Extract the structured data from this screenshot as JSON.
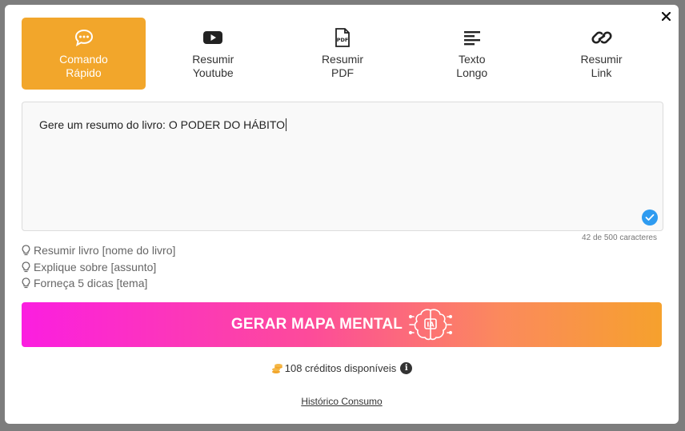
{
  "tabs": [
    {
      "label": "Comando\nRápido",
      "icon": "chat-bubble-icon",
      "active": true
    },
    {
      "label": "Resumir\nYoutube",
      "icon": "youtube-icon",
      "active": false
    },
    {
      "label": "Resumir\nPDF",
      "icon": "pdf-file-icon",
      "active": false
    },
    {
      "label": "Texto\nLongo",
      "icon": "align-left-icon",
      "active": false
    },
    {
      "label": "Resumir\nLink",
      "icon": "link-icon",
      "active": false
    }
  ],
  "prompt": {
    "value": "Gere um resumo do livro: O PODER DO HÁBITO",
    "char_count": "42 de 500 caracteres"
  },
  "suggestions": [
    "Resumir livro [nome do livro]",
    "Explique sobre [assunto]",
    "Forneça 5 dicas [tema]"
  ],
  "generate_button": {
    "label": "GERAR MAPA MENTAL",
    "icon": "ai-brain-icon"
  },
  "credits": {
    "text": "108 créditos disponíveis",
    "icon": "coins-icon",
    "info_icon": "info-icon"
  },
  "history_link": "Histórico Consumo",
  "colors": {
    "active_tab": "#f2a62b",
    "gradient_start": "#fb1ee0",
    "gradient_end": "#f6a12d",
    "check": "#2e9bf0"
  }
}
